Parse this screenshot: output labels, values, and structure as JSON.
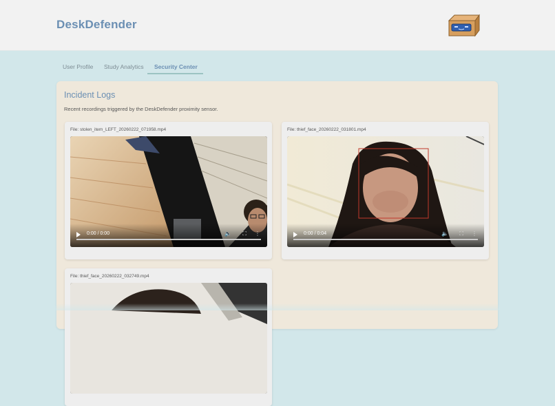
{
  "app": {
    "brand": "DeskDefender",
    "logo_icon": "robot-box-icon"
  },
  "tabs": [
    {
      "label": "User Profile",
      "active": false
    },
    {
      "label": "Study Analytics",
      "active": false
    },
    {
      "label": "Security Center",
      "active": true
    }
  ],
  "incidents": {
    "title": "Incident Logs",
    "description": "Recent recordings triggered by the DeskDefender proximity sensor.",
    "recordings": [
      {
        "file_label": "File: stolen_item_LEFT_20260222_071958.mp4",
        "time": "0:00 / 0:00",
        "face_box": false
      },
      {
        "file_label": "File: thief_face_20260222_031801.mp4",
        "time": "0:00 / 0:04",
        "face_box": true
      },
      {
        "file_label": "File: thief_face_20260222_032749.mp4",
        "time": "",
        "face_box": false
      }
    ]
  },
  "colors": {
    "accent": "#6b8fb3",
    "page_bg": "#d2e7ea",
    "panel_bg": "#efe8db",
    "face_box": "#c0392b"
  }
}
